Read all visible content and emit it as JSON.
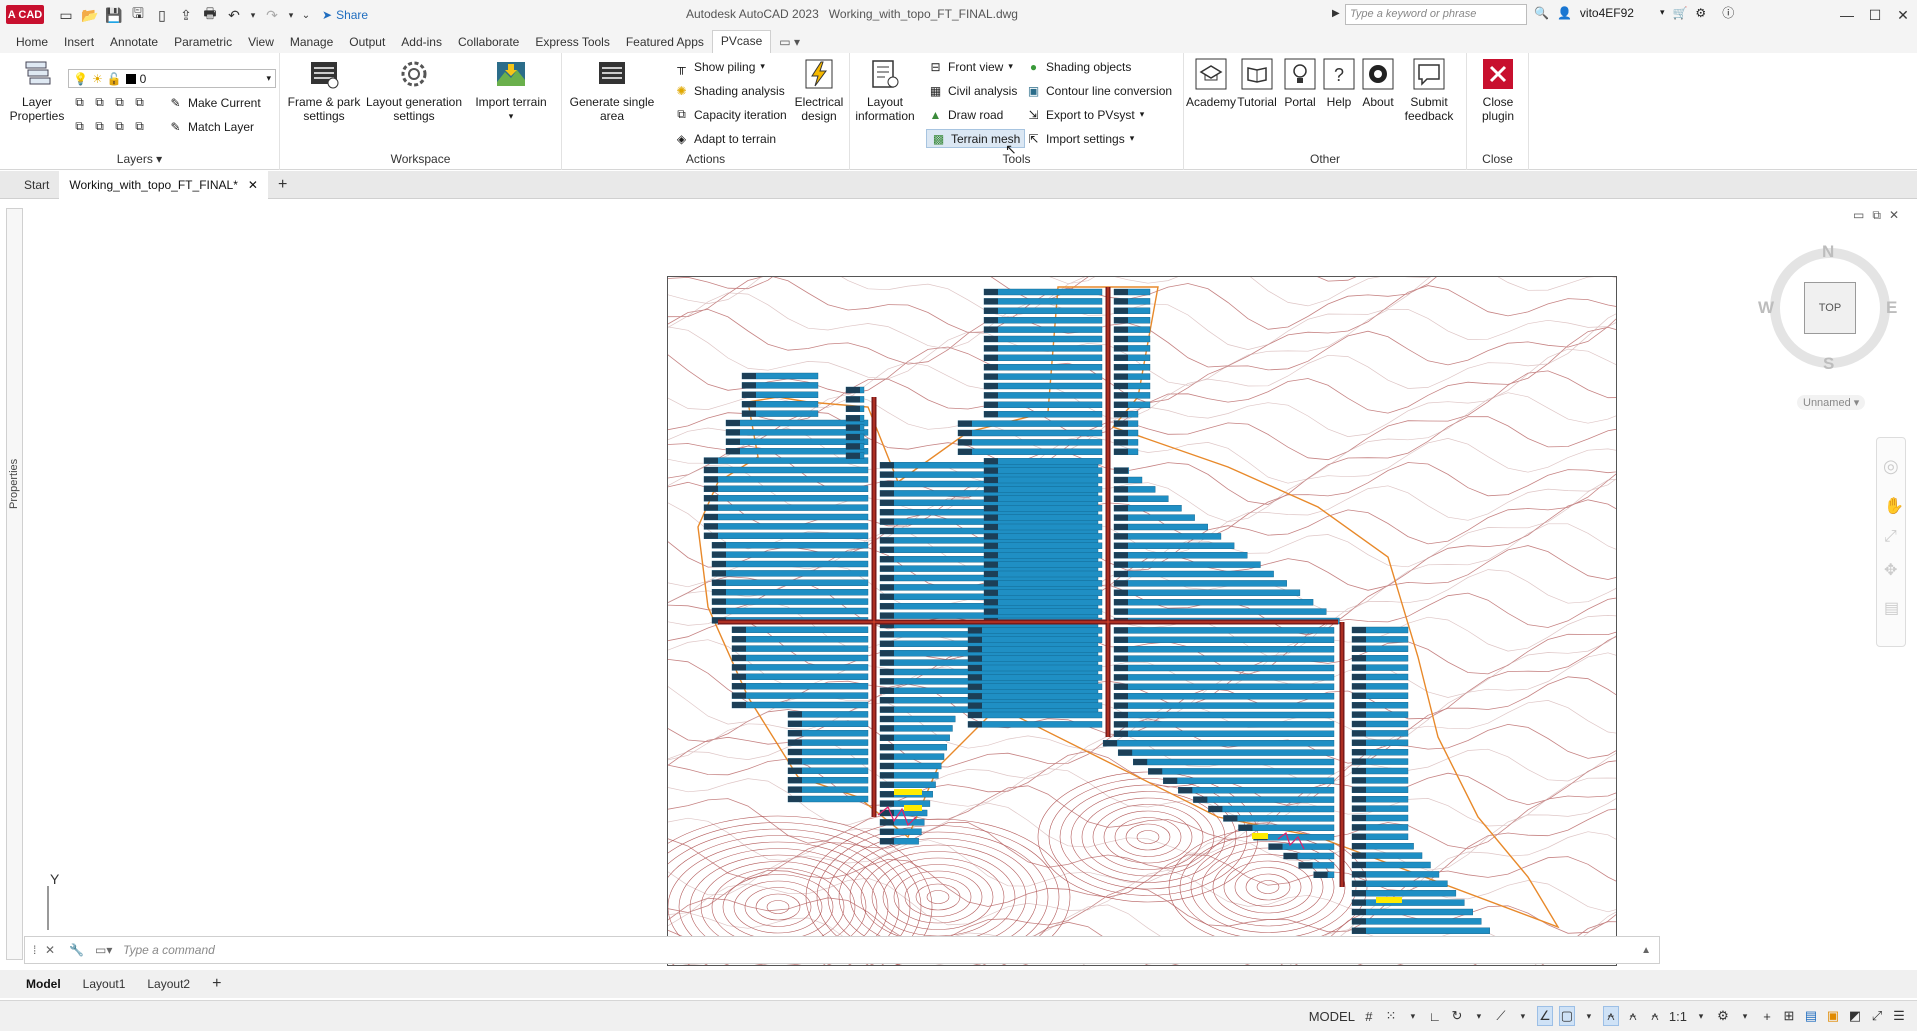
{
  "app": {
    "logo": "A CAD",
    "title": "Autodesk AutoCAD 2023",
    "file": "Working_with_topo_FT_FINAL.dwg",
    "share": "Share",
    "search_placeholder": "Type a keyword or phrase",
    "user": "vito4EF92"
  },
  "ribbon_tabs": [
    "Home",
    "Insert",
    "Annotate",
    "Parametric",
    "View",
    "Manage",
    "Output",
    "Add-ins",
    "Collaborate",
    "Express Tools",
    "Featured Apps",
    "PVcase"
  ],
  "active_tab": "PVcase",
  "panels": {
    "layers": {
      "title": "Layers",
      "layer_properties": "Layer\nProperties",
      "current_layer": "0",
      "make_current": "Make Current",
      "match_layer": "Match Layer"
    },
    "workspace": {
      "title": "Workspace",
      "frame_park": "Frame & park\nsettings",
      "layout_gen": "Layout generation\nsettings",
      "import_terrain": "Import terrain"
    },
    "actions": {
      "title": "Actions",
      "generate_single": "Generate single\narea",
      "show_piling": "Show piling",
      "shading_analysis": "Shading analysis",
      "capacity_iteration": "Capacity iteration",
      "adapt_to_terrain": "Adapt to terrain",
      "electrical_design": "Electrical\ndesign"
    },
    "tools": {
      "title": "Tools",
      "layout_information": "Layout\ninformation",
      "front_view": "Front view",
      "civil_analysis": "Civil analysis",
      "draw_road": "Draw road",
      "terrain_mesh": "Terrain mesh",
      "shading_objects": "Shading objects",
      "contour_line_conversion": "Contour line conversion",
      "export_pvsyst": "Export to PVsyst",
      "import_settings": "Import settings"
    },
    "other": {
      "title": "Other",
      "academy": "Academy",
      "tutorial": "Tutorial",
      "portal": "Portal",
      "help": "Help",
      "about": "About",
      "submit_feedback": "Submit\nfeedback"
    },
    "close": {
      "title": "Close",
      "close_plugin": "Close\nplugin"
    }
  },
  "doc_tabs": {
    "start": "Start",
    "active": "Working_with_topo_FT_FINAL*"
  },
  "side_palette": "Properties",
  "viewcube": {
    "n": "N",
    "s": "S",
    "e": "E",
    "w": "W",
    "face": "TOP",
    "ucs": "Unnamed"
  },
  "ucs_axis": "Y",
  "command": {
    "placeholder": "Type a command"
  },
  "layout_tabs": [
    "Model",
    "Layout1",
    "Layout2"
  ],
  "status": {
    "model": "MODEL",
    "scale": "1:1"
  },
  "colors": {
    "accent": "#c8102e",
    "panel_blue": "#1f8fc4",
    "contour": "#b35a5a",
    "boundary": "#e8892a",
    "road": "#7a1a1a"
  }
}
